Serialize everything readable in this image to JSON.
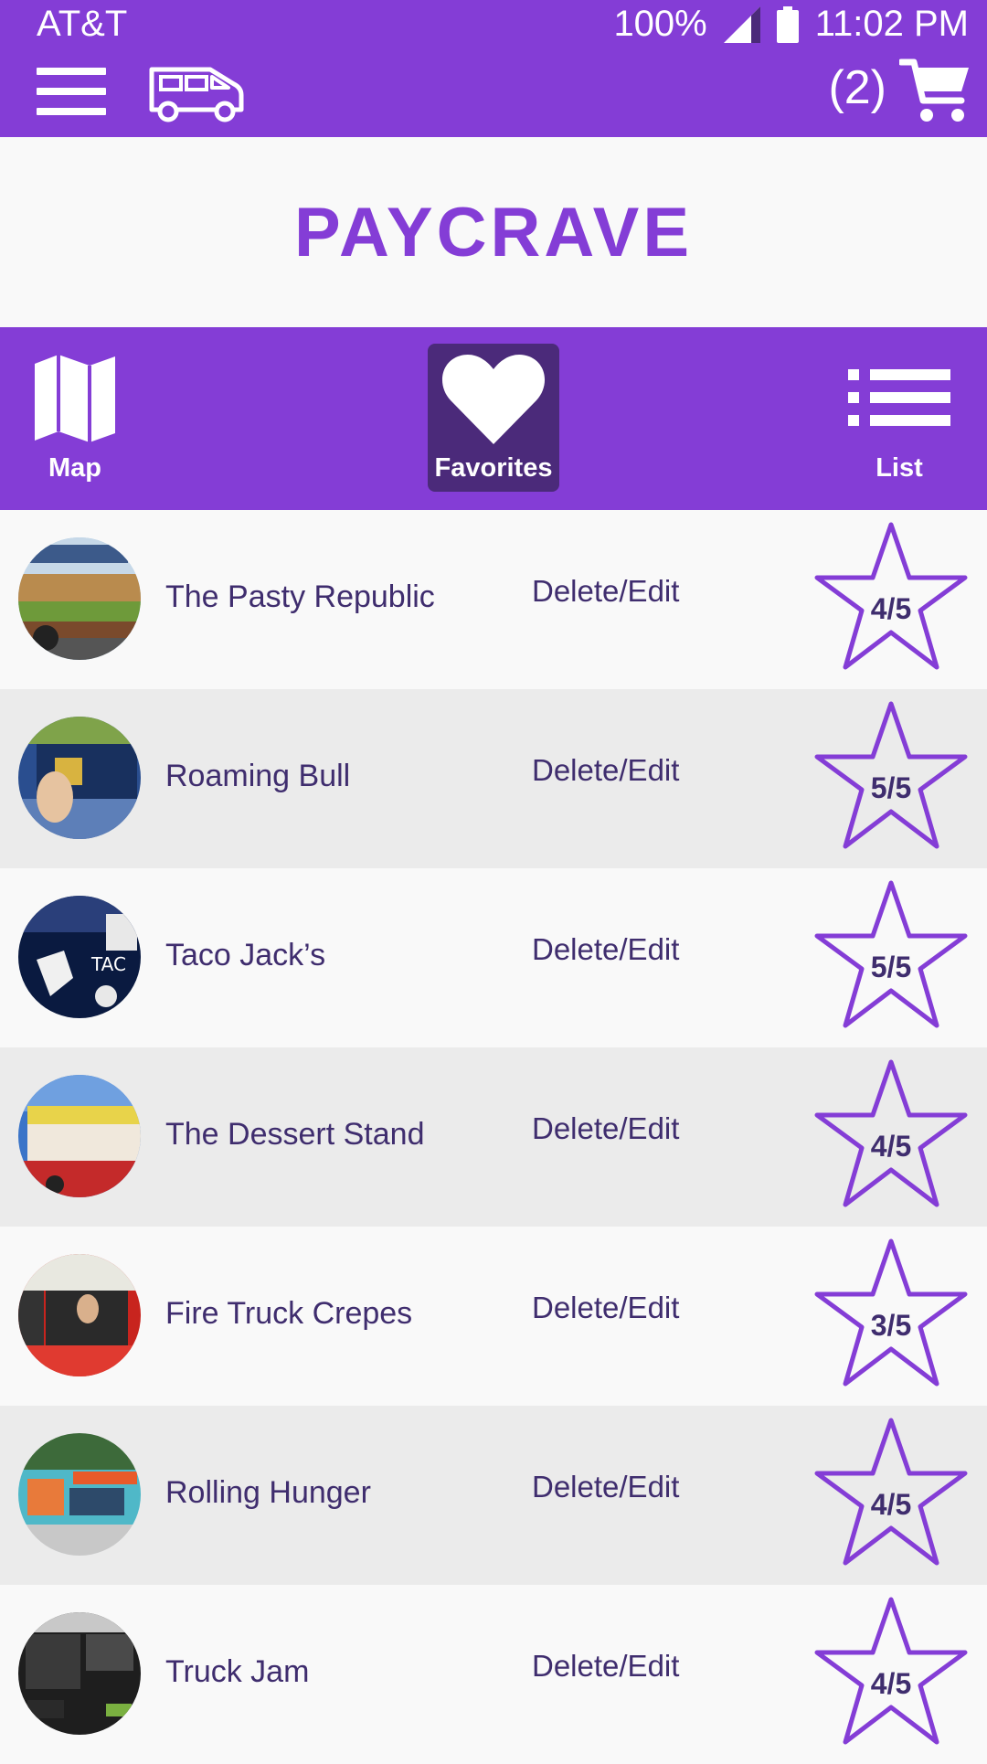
{
  "status_bar": {
    "carrier": "AT&T",
    "battery": "100%",
    "time": "11:02 PM"
  },
  "header": {
    "cart_count": "(2)",
    "menu_icon": "hamburger-menu-icon",
    "truck_icon": "food-truck-icon",
    "cart_icon": "shopping-cart-icon"
  },
  "brand": {
    "title": "PAYCRAVE"
  },
  "tabs": [
    {
      "label": "Map",
      "icon": "map-icon",
      "active": false
    },
    {
      "label": "Favorites",
      "icon": "heart-icon",
      "active": true
    },
    {
      "label": "List",
      "icon": "list-icon",
      "active": false
    }
  ],
  "favorites": [
    {
      "name": "The Pasty Republic",
      "action": "Delete/Edit",
      "rating": "4/5"
    },
    {
      "name": "Roaming Bull",
      "action": "Delete/Edit",
      "rating": "5/5"
    },
    {
      "name": "Taco Jack’s",
      "action": "Delete/Edit",
      "rating": "5/5"
    },
    {
      "name": "The Dessert Stand",
      "action": "Delete/Edit",
      "rating": "4/5"
    },
    {
      "name": "Fire Truck Crepes",
      "action": "Delete/Edit",
      "rating": "3/5"
    },
    {
      "name": "Rolling Hunger",
      "action": "Delete/Edit",
      "rating": "4/5"
    },
    {
      "name": "Truck Jam",
      "action": "Delete/Edit",
      "rating": "4/5"
    }
  ],
  "colors": {
    "brand": "#843dd6",
    "active_tab": "#4b2a7a",
    "text": "#3f2d6e",
    "row_alt": "#ebebeb"
  }
}
